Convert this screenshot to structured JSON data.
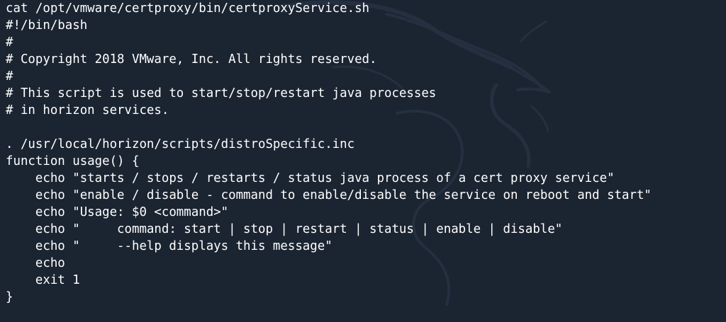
{
  "terminal": {
    "background_color": "#1b2431",
    "text_color": "#ffffff",
    "background_watermark_icon": "kali-dragon-icon",
    "lines": [
      "cat /opt/vmware/certproxy/bin/certproxyService.sh",
      "#!/bin/bash",
      "#",
      "# Copyright 2018 VMware, Inc. All rights reserved.",
      "#",
      "# This script is used to start/stop/restart java processes",
      "# in horizon services.",
      "",
      ". /usr/local/horizon/scripts/distroSpecific.inc",
      "function usage() {",
      "    echo \"starts / stops / restarts / status java process of a cert proxy service\"",
      "    echo \"enable / disable - command to enable/disable the service on reboot and start\"",
      "    echo \"Usage: $0 <command>\"",
      "    echo \"     command: start | stop | restart | status | enable | disable\"",
      "    echo \"     --help displays this message\"",
      "    echo",
      "    exit 1",
      "}"
    ]
  }
}
